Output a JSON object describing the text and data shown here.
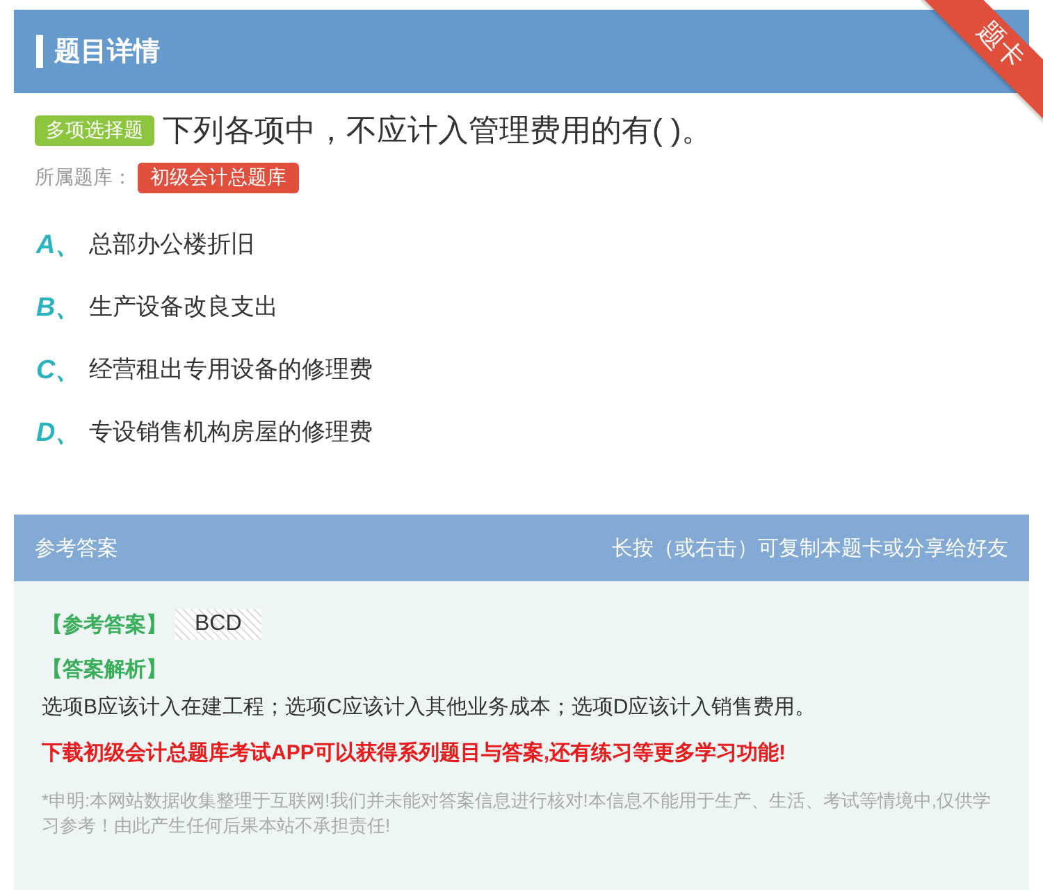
{
  "header": {
    "title": "题目详情",
    "ribbon": "题卡"
  },
  "question": {
    "type_badge": "多项选择题",
    "text": "下列各项中，不应计入管理费用的有( )。",
    "bank_label": "所属题库：",
    "bank": "初级会计总题库"
  },
  "options": [
    {
      "letter": "A、",
      "text": "总部办公楼折旧"
    },
    {
      "letter": "B、",
      "text": "生产设备改良支出"
    },
    {
      "letter": "C、",
      "text": "经营租出专用设备的修理费"
    },
    {
      "letter": "D、",
      "text": "专设销售机构房屋的修理费"
    }
  ],
  "answer_section": {
    "title": "参考答案",
    "hint": "长按（或右击）可复制本题卡或分享给好友",
    "answer_label": "【参考答案】",
    "answer": "BCD",
    "analysis_label": "【答案解析】",
    "analysis": "选项B应该计入在建工程；选项C应该计入其他业务成本；选项D应该计入销售费用。",
    "promo": "下载初级会计总题库考试APP可以获得系列题目与答案,还有练习等更多学习功能!",
    "disclaimer": "*申明:本网站数据收集整理于互联网!我们并未能对答案信息进行核对!本信息不能用于生产、生活、考试等情境中,仅供学习参考！由此产生任何后果本站不承担责任!"
  }
}
